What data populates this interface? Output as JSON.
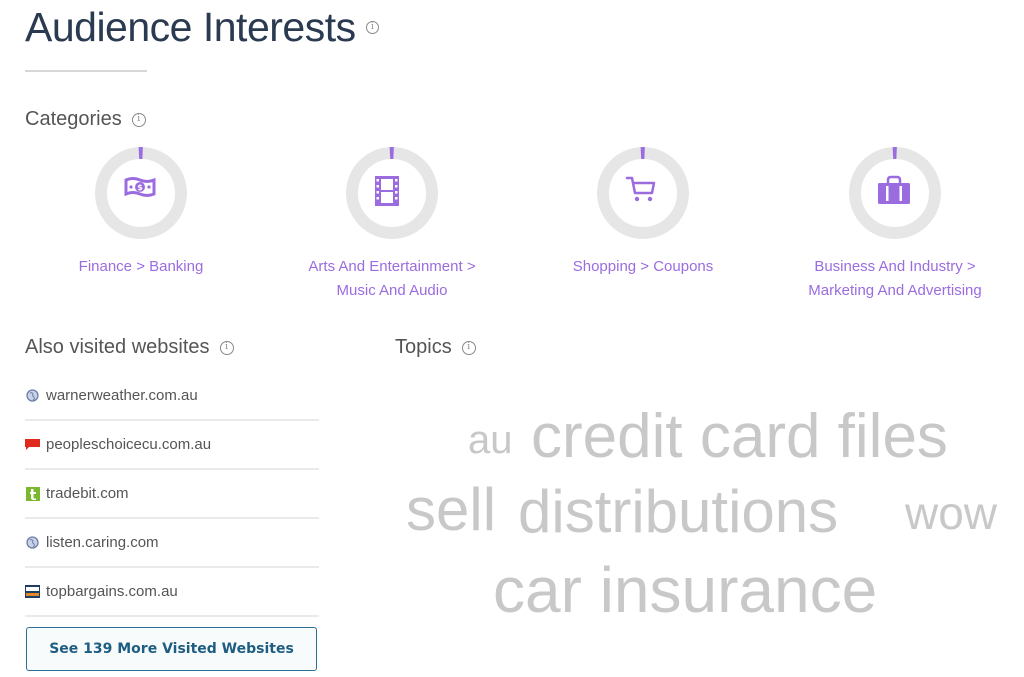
{
  "header": {
    "title": "Audience Interests",
    "info_glyph": "i"
  },
  "categories": {
    "heading": "Categories",
    "info_glyph": "i",
    "accent_color": "#9b6ce0",
    "ring_color": "#e6e6e6",
    "items": [
      {
        "label_line1": "Finance > Banking",
        "label_line2": "",
        "icon": "money-icon",
        "share_percent": 1.5
      },
      {
        "label_line1": "Arts And Entertainment >",
        "label_line2": "Music And Audio",
        "icon": "film-icon",
        "share_percent": 1.5
      },
      {
        "label_line1": "Shopping > Coupons",
        "label_line2": "",
        "icon": "shopping-cart-icon",
        "share_percent": 1.5
      },
      {
        "label_line1": "Business And Industry >",
        "label_line2": "Marketing And Advertising",
        "icon": "briefcase-icon",
        "share_percent": 1.5
      }
    ]
  },
  "also_visited": {
    "heading": "Also visited websites",
    "info_glyph": "i",
    "sites": [
      {
        "domain": "warnerweather.com.au",
        "favicon": "globe-icon"
      },
      {
        "domain": "peopleschoicecu.com.au",
        "favicon": "red-flag-icon"
      },
      {
        "domain": "tradebit.com",
        "favicon": "tradebit-t-icon"
      },
      {
        "domain": "listen.caring.com",
        "favicon": "globe-icon"
      },
      {
        "domain": "topbargains.com.au",
        "favicon": "topbargains-icon"
      }
    ],
    "more_button": "See 139 More Visited Websites"
  },
  "topics": {
    "heading": "Topics",
    "info_glyph": "i",
    "words": [
      {
        "text": "au",
        "weight": 1
      },
      {
        "text": "credit card files",
        "weight": 3
      },
      {
        "text": "sell",
        "weight": 2
      },
      {
        "text": "distributions",
        "weight": 3
      },
      {
        "text": "wow",
        "weight": 1
      },
      {
        "text": "car insurance",
        "weight": 3
      }
    ]
  }
}
